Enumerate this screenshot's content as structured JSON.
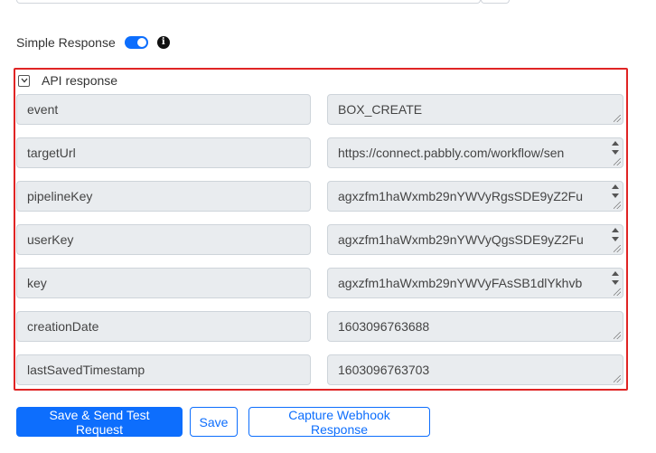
{
  "simple_response": {
    "label": "Simple Response",
    "enabled": true,
    "toggle_color": "#0d6efd"
  },
  "api_response": {
    "title": "API response",
    "border_color": "#e02424",
    "fields": [
      {
        "key": "event",
        "value": "BOX_CREATE",
        "value_line2": ""
      },
      {
        "key": "targetUrl",
        "value": "https://connect.pabbly.com/workflow/sen",
        "value_line2": "··· ··· ·· ·· ·"
      },
      {
        "key": "pipelineKey",
        "value": "agxzfm1haWxmb29nYWVyRgsSDE9yZ2Fu",
        "value_line2": "··· ·· ·· · ·· · ··· ·· ·· ·"
      },
      {
        "key": "userKey",
        "value": "agxzfm1haWxmb29nYWVyQgsSDE9yZ2Fu",
        "value_line2": "··· ·· ·· · ·· · ··· ·· ·· ·"
      },
      {
        "key": "key",
        "value": "agxzfm1haWxmb29nYWVyFAsSB1dlYkhvb",
        "value_line2": "··· ·· ·· · ·· ·"
      },
      {
        "key": "creationDate",
        "value": "1603096763688",
        "value_line2": ""
      },
      {
        "key": "lastSavedTimestamp",
        "value": "1603096763703",
        "value_line2": ""
      }
    ]
  },
  "buttons": {
    "save_send": "Save & Send Test Request",
    "save": "Save",
    "capture": "Capture Webhook Response"
  }
}
